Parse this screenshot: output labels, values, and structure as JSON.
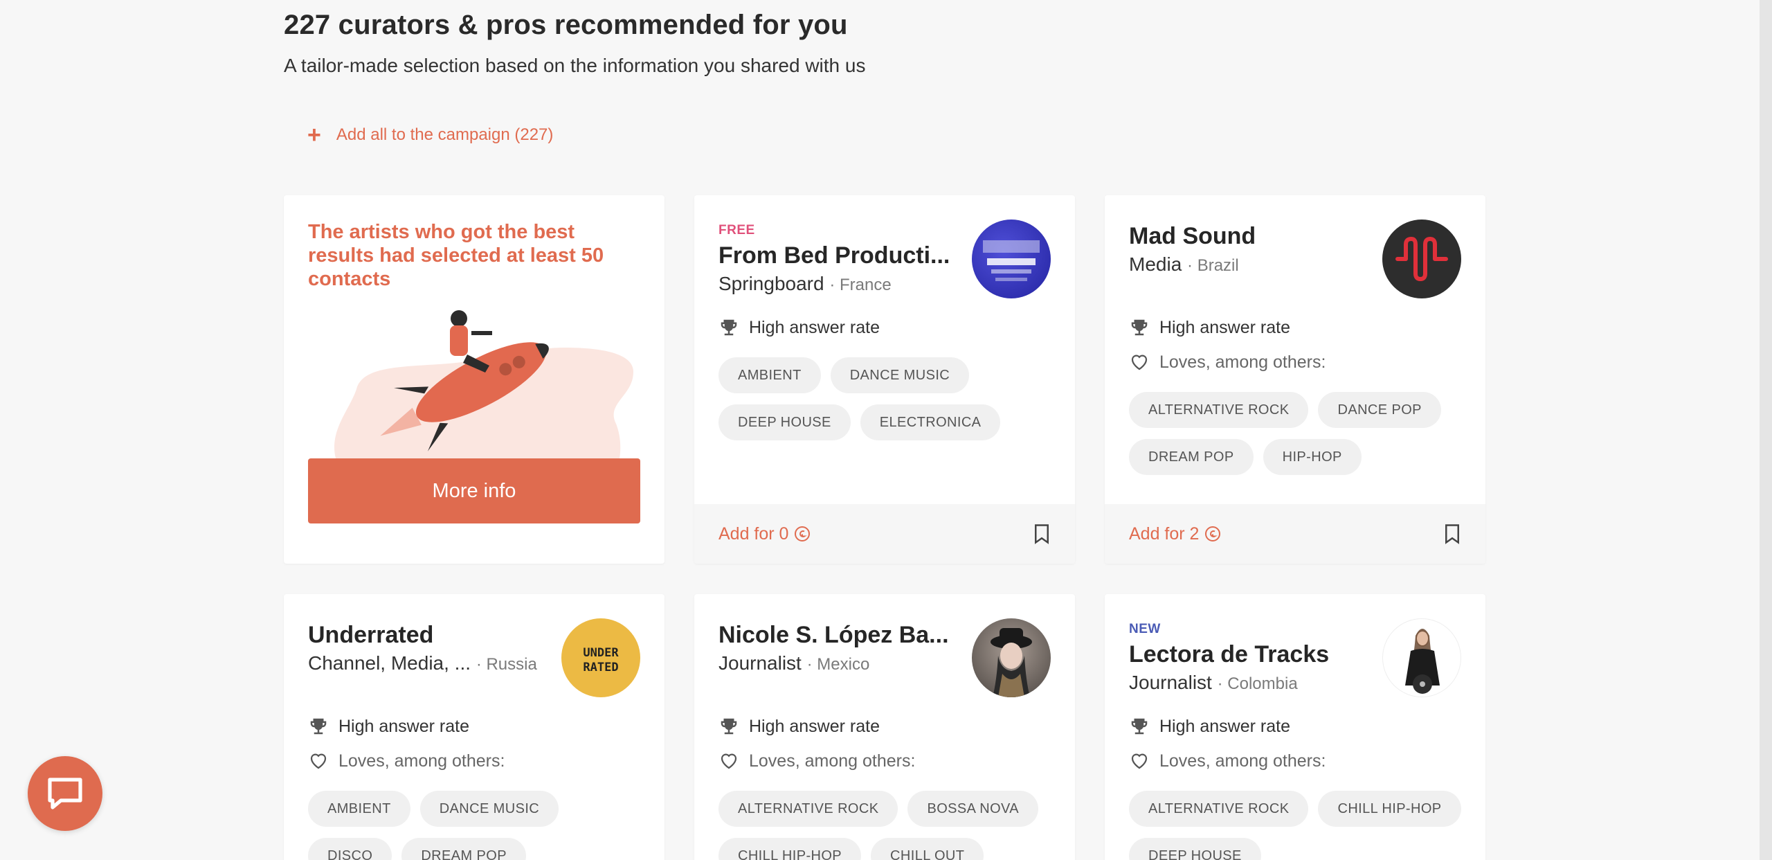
{
  "header": {
    "title": "227 curators & pros recommended for you",
    "subtitle": "A tailor-made selection based on the information you shared with us",
    "add_all_label": "Add all to the campaign (227)"
  },
  "promo": {
    "text": "The artists who got the best results had selected at least 50 contacts",
    "button_label": "More info"
  },
  "common": {
    "high_answer_rate": "High answer rate",
    "loves_label": "Loves, among others:"
  },
  "curators": [
    {
      "badge": "FREE",
      "name": "From Bed Producti...",
      "type": "Springboard",
      "location": "· France",
      "tags": [
        "AMBIENT",
        "DANCE MUSIC",
        "DEEP HOUSE",
        "ELECTRONICA"
      ],
      "add_label": "Add for 0"
    },
    {
      "badge": "",
      "name": "Mad Sound",
      "type": "Media",
      "location": "· Brazil",
      "tags": [
        "ALTERNATIVE ROCK",
        "DANCE POP",
        "DREAM POP",
        "HIP-HOP"
      ],
      "add_label": "Add for 2"
    },
    {
      "badge": "",
      "name": "Underrated",
      "type": "Channel, Media, ...",
      "location": "· Russia",
      "logo_text": "UNDER RATED",
      "tags": [
        "AMBIENT",
        "DANCE MUSIC",
        "DISCO",
        "DREAM POP"
      ]
    },
    {
      "badge": "",
      "name": "Nicole S. López Ba...",
      "type": "Journalist",
      "location": "· Mexico",
      "tags": [
        "ALTERNATIVE ROCK",
        "BOSSA NOVA",
        "CHILL HIP-HOP",
        "CHILL OUT"
      ]
    },
    {
      "badge": "NEW",
      "name": "Lectora de Tracks",
      "type": "Journalist",
      "location": "· Colombia",
      "tags": [
        "ALTERNATIVE ROCK",
        "CHILL HIP-HOP",
        "DEEP HOUSE"
      ]
    }
  ],
  "colors": {
    "accent": "#df6b4f",
    "free_badge": "#e0507a",
    "new_badge": "#4a5bb5",
    "background": "#f7f7f7"
  },
  "icons": {
    "rate": "trophy-icon",
    "loves": "heart-icon",
    "save": "bookmark-icon",
    "credit": "credit-coin-icon",
    "chat": "chat-bubble-icon"
  }
}
